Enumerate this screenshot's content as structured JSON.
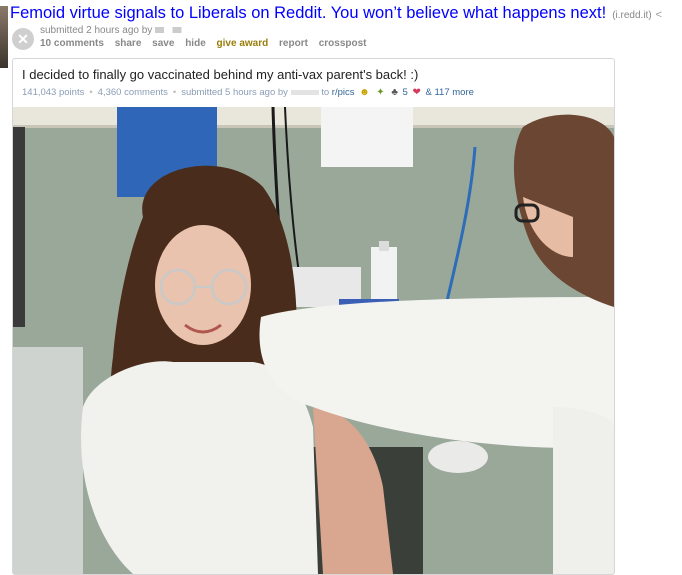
{
  "post": {
    "title": "Femoid virtue signals to Liberals on Reddit. You won’t believe what happens next!",
    "domain": "(i.redd.it)",
    "submitted": "submitted 2 hours ago by",
    "buttons": {
      "comments": "10 comments",
      "share": "share",
      "save": "save",
      "hide": "hide",
      "give_award": "give award",
      "report": "report",
      "crosspost": "crosspost"
    }
  },
  "embed": {
    "title": "I decided to finally go vaccinated behind my anti-vax parent's back! :)",
    "points": "141,043 points",
    "comments": "4,360 comments",
    "submitted": "submitted 5 hours ago by",
    "to": "to",
    "subreddit": "r/pics",
    "award_count": "5",
    "more_awards": "& 117 more"
  },
  "icons": [
    "close-icon",
    "share-icon",
    "award-icon"
  ]
}
